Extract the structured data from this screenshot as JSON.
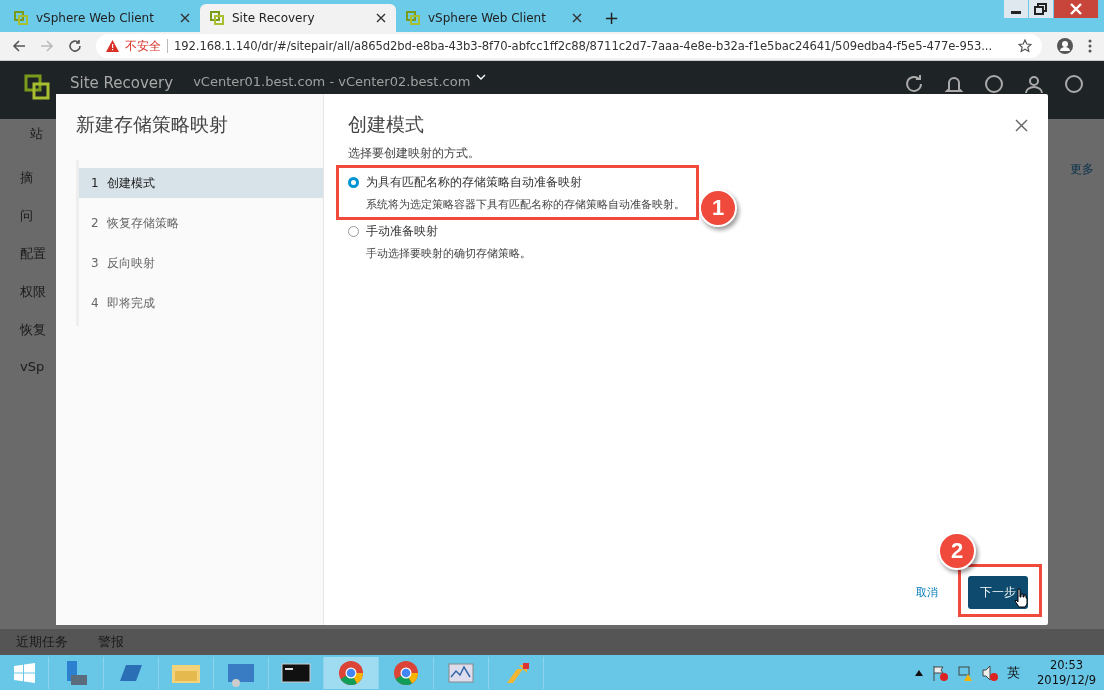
{
  "browser": {
    "tabs": [
      {
        "title": "vSphere Web Client",
        "selected": false
      },
      {
        "title": "Site Recovery",
        "selected": true
      },
      {
        "title": "vSphere Web Client",
        "selected": false
      }
    ],
    "new_tab": "+",
    "security": "不安全",
    "url": "192.168.1.140/dr/#/sitepair/all/a865d2bd-e8ba-43b3-8f70-abfcc1ff2c88/8711c2d7-7aaa-4e8e-b32a-f1e5bac24641/509edba4-f5e5-477e-953..."
  },
  "app": {
    "name": "Site Recovery",
    "site_pair": "vCenter01.best.com - vCenter02.best.com",
    "tab": "站",
    "sidebar": [
      "摘",
      "问",
      "配置",
      "权限",
      "恢复",
      "vSp"
    ],
    "more": "更多",
    "bottom_tabs": [
      "近期任务",
      "警报"
    ]
  },
  "dialog": {
    "title": "新建存储策略映射",
    "steps": [
      {
        "number": "1",
        "label": "创建模式",
        "selected": true
      },
      {
        "number": "2",
        "label": "恢复存储策略",
        "selected": false
      },
      {
        "number": "3",
        "label": "反向映射",
        "selected": false
      },
      {
        "number": "4",
        "label": "即将完成",
        "selected": false
      }
    ],
    "heading": "创建模式",
    "subtitle": "选择要创建映射的方式。",
    "options": [
      {
        "label": "为具有匹配名称的存储策略自动准备映射",
        "description": "系统将为选定策略容器下具有匹配名称的存储策略自动准备映射。",
        "selected": true
      },
      {
        "label": "手动准备映射",
        "description": "手动选择要映射的确切存储策略。",
        "selected": false
      }
    ],
    "cancel": "取消",
    "next": "下一步"
  },
  "annotations": [
    "1",
    "2"
  ],
  "taskbar": {
    "ime": "英",
    "time": "20:53",
    "date": "2019/12/9"
  }
}
